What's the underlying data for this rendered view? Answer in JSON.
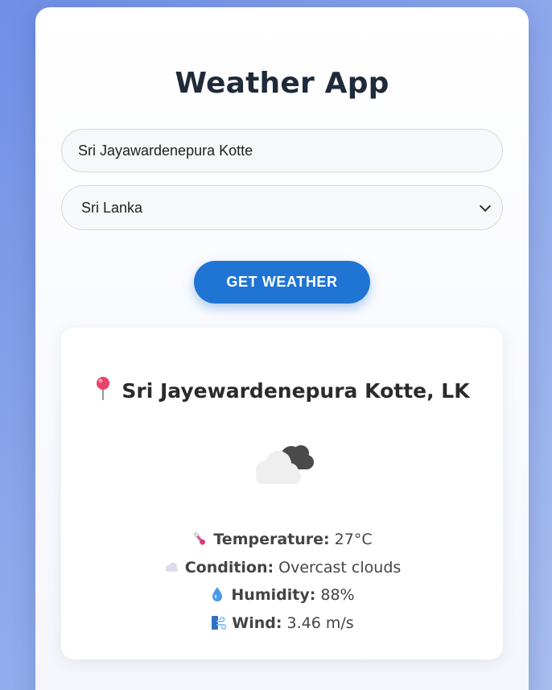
{
  "app": {
    "title": "Weather App"
  },
  "search": {
    "city_value": "Sri Jayawardenepura Kotte",
    "country_selected": "Sri Lanka",
    "button_label": "GET WEATHER"
  },
  "result": {
    "location": "Sri Jayewardenepura Kotte, LK",
    "location_icon": "pin-icon",
    "weather_icon": "overcast-clouds-icon",
    "details": [
      {
        "icon": "thermometer-icon",
        "label": "Temperature:",
        "value": " 27°C"
      },
      {
        "icon": "cloud-icon",
        "label": "Condition:",
        "value": " Overcast clouds"
      },
      {
        "icon": "droplet-icon",
        "label": "Humidity:",
        "value": " 88%"
      },
      {
        "icon": "wind-icon",
        "label": "Wind:",
        "value": " 3.46 m/s"
      }
    ]
  },
  "colors": {
    "accent": "#1f74d4",
    "background_start": "#6f8ee6",
    "background_end": "#a9bff0",
    "card": "#ffffff",
    "title_text": "#1f2a3a"
  }
}
